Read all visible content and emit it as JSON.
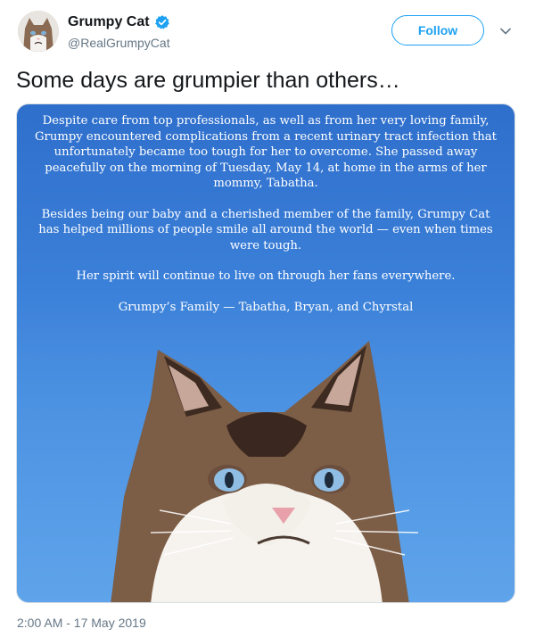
{
  "user": {
    "display_name": "Grumpy Cat",
    "handle": "@RealGrumpyCat",
    "avatar_icon": "grumpy-cat-avatar",
    "verified_icon": "verified-badge-icon"
  },
  "actions": {
    "follow_label": "Follow",
    "more_icon": "chevron-down-icon"
  },
  "tweet": {
    "text": "Some days are grumpier than others…",
    "timestamp": "2:00 AM - 17 May 2019"
  },
  "media": {
    "statement": {
      "p1": "Despite care from top professionals, as well as from her very loving family, Grumpy encountered complications from a recent urinary tract infection that unfortunately became too tough for her to overcome.  She passed away peacefully on the morning of Tuesday, May 14, at home in the arms of her mommy, Tabatha.",
      "p2": "Besides being our baby and a cherished member of the family, Grumpy Cat has helped millions of people smile all around the world — even when times were tough.",
      "p3": "Her spirit will continue to live on through her fans everywhere.",
      "signature": "Grumpy’s Family — Tabatha, Bryan, and Chyrstal"
    }
  },
  "colors": {
    "accent": "#1da1f2",
    "secondary_text": "#657786",
    "media_sky": "#3a7fd8"
  }
}
